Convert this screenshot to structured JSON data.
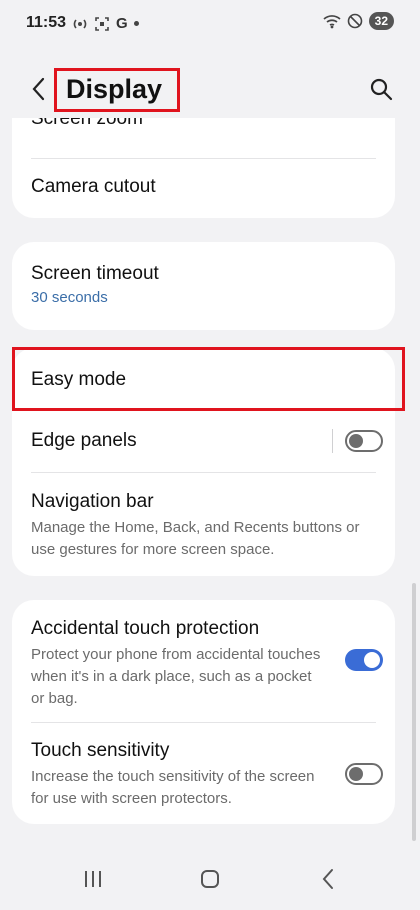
{
  "status_bar": {
    "time": "11:53",
    "battery": "32"
  },
  "header": {
    "title": "Display"
  },
  "items": {
    "screen_zoom": {
      "title": "Screen zoom"
    },
    "camera_cutout": {
      "title": "Camera cutout"
    },
    "screen_timeout": {
      "title": "Screen timeout",
      "value": "30 seconds"
    },
    "easy_mode": {
      "title": "Easy mode"
    },
    "edge_panels": {
      "title": "Edge panels",
      "enabled": false
    },
    "navigation_bar": {
      "title": "Navigation bar",
      "subtitle": "Manage the Home, Back, and Recents buttons or use gestures for more screen space."
    },
    "accidental_touch": {
      "title": "Accidental touch protection",
      "subtitle": "Protect your phone from accidental touches when it's in a dark place, such as a pocket or bag.",
      "enabled": true
    },
    "touch_sensitivity": {
      "title": "Touch sensitivity",
      "subtitle": "Increase the touch sensitivity of the screen for use with screen protectors.",
      "enabled": false
    }
  },
  "colors": {
    "accent": "#3a6cd6",
    "highlight": "#e0141e",
    "value_text": "#3b6ea8"
  },
  "icons": [
    "back-icon",
    "search-icon",
    "recents-icon",
    "home-icon",
    "nav-back-icon"
  ]
}
